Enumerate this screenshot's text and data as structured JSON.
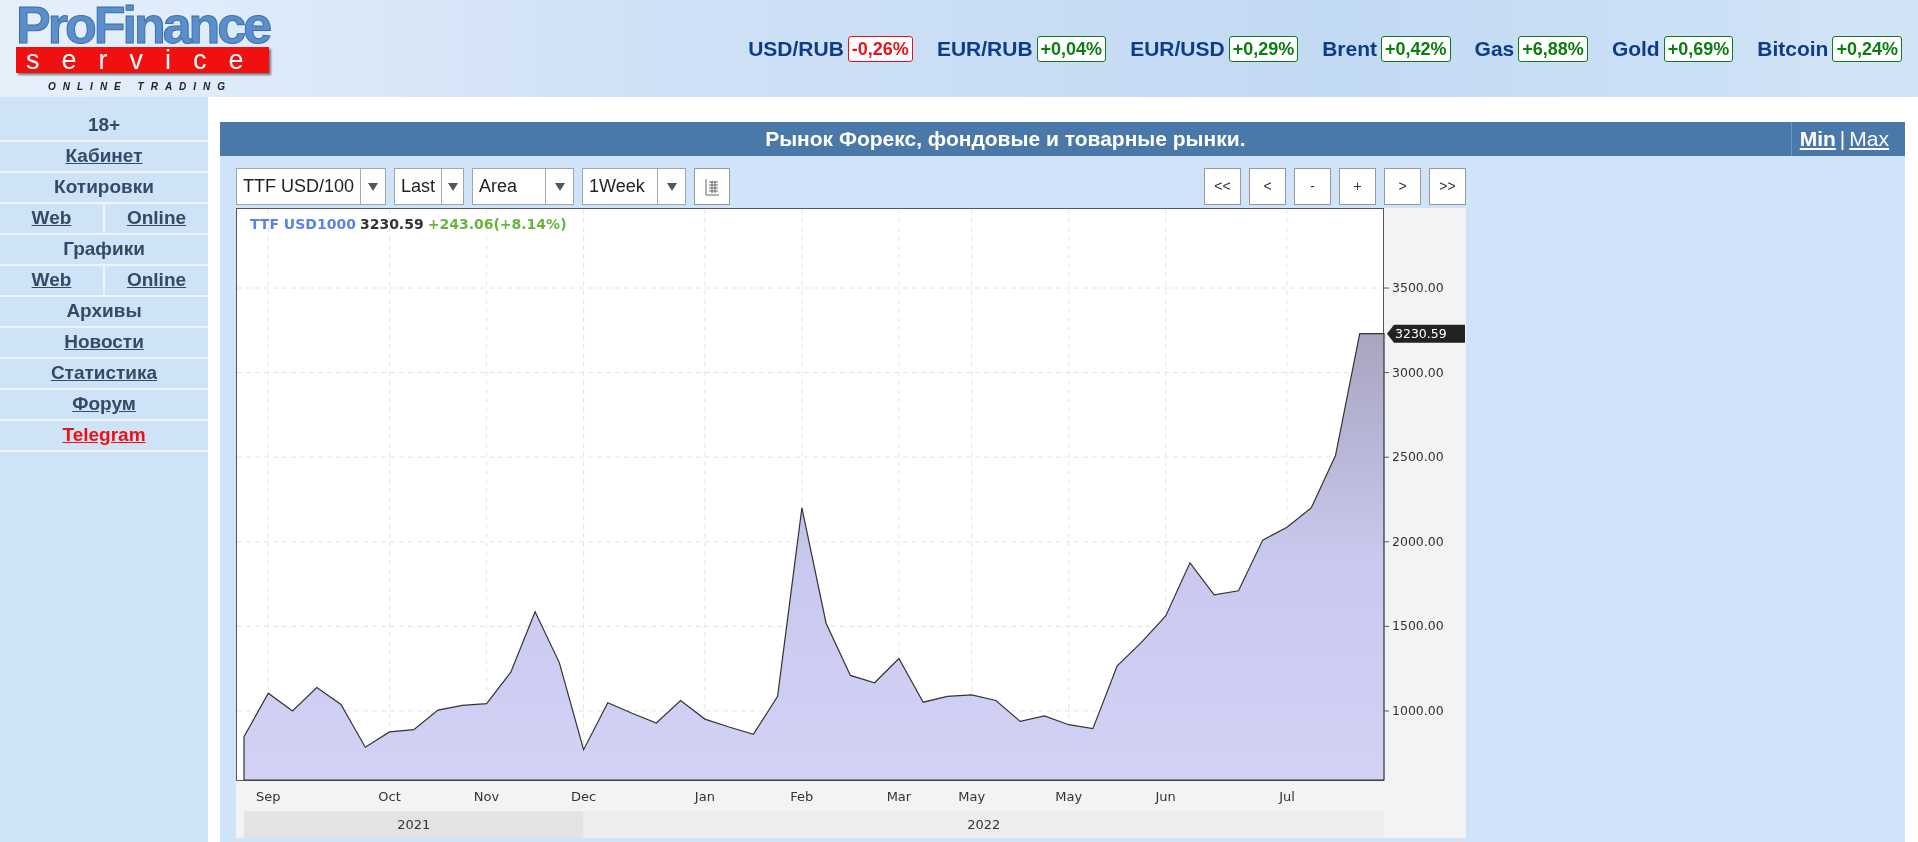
{
  "header": {
    "logo": {
      "brand": "ProFinance",
      "sub": "service",
      "tagline": "ONLINE TRADING"
    },
    "tickers": [
      {
        "name": "USD/RUB",
        "change": "-0,26%",
        "color": "#e4141e"
      },
      {
        "name": "EUR/RUB",
        "change": "+0,04%",
        "color": "#0c7d12"
      },
      {
        "name": "EUR/USD",
        "change": "+0,29%",
        "color": "#0c7d12"
      },
      {
        "name": "Brent",
        "change": "+0,42%",
        "color": "#0c7d12"
      },
      {
        "name": "Gas",
        "change": "+6,88%",
        "color": "#0c7d12"
      },
      {
        "name": "Gold",
        "change": "+0,69%",
        "color": "#0c7d12"
      },
      {
        "name": "Bitcoin",
        "change": "+0,24%",
        "color": "#0c7d12"
      }
    ]
  },
  "sidebar": {
    "items": [
      {
        "kind": "heading",
        "label": "18+"
      },
      {
        "kind": "link",
        "label": "Кабинет"
      },
      {
        "kind": "heading",
        "label": "Котировки"
      },
      {
        "kind": "pair",
        "links": [
          "Web",
          "Online"
        ]
      },
      {
        "kind": "heading",
        "label": "Графики"
      },
      {
        "kind": "pair",
        "links": [
          "Web",
          "Online"
        ]
      },
      {
        "kind": "heading",
        "label": "Архивы"
      },
      {
        "kind": "link",
        "label": "Новости"
      },
      {
        "kind": "link",
        "label": "Статистика"
      },
      {
        "kind": "link",
        "label": "Форум"
      },
      {
        "kind": "accent",
        "label": "Telegram"
      }
    ]
  },
  "panel": {
    "title": "Рынок Форекс, фондовые и товарные рынки.",
    "size_links": [
      {
        "label": "Min",
        "selected": true
      },
      {
        "label": "Max",
        "selected": false
      }
    ],
    "separator": "|",
    "selects": [
      {
        "value": "TTF USD/100"
      },
      {
        "value": "Last"
      },
      {
        "value": "Area"
      },
      {
        "value": "1Week"
      }
    ],
    "nav_buttons": [
      "<<",
      "<",
      "-",
      "+",
      ">",
      ">>"
    ],
    "chart": {
      "legend": {
        "price": "3230.59",
        "change": "+243.06(+8.14%)"
      },
      "price_tag": "3230.59",
      "years": [
        {
          "label": "2021"
        },
        {
          "label": "2022"
        }
      ],
      "chart_data": {
        "type": "area",
        "categories": [
          null,
          "Sep",
          null,
          null,
          null,
          null,
          "Oct",
          null,
          null,
          null,
          "Nov",
          null,
          null,
          null,
          "Dec",
          null,
          null,
          null,
          null,
          "Jan",
          null,
          null,
          null,
          "Feb",
          null,
          null,
          null,
          "Mar",
          null,
          null,
          "May",
          null,
          null,
          null,
          "May",
          null,
          null,
          null,
          "Jun",
          null,
          null,
          null,
          null,
          "Jul",
          null,
          null,
          null,
          null
        ],
        "series": [
          {
            "name": "TTF USD1000",
            "color": "#333333",
            "values": [
              848,
              1105,
              1000,
              1138,
              1038,
              786,
              876,
              890,
              1005,
              1033,
              1043,
              1229,
              1586,
              1286,
              771,
              1048,
              986,
              929,
              1062,
              952,
              905,
              862,
              1086,
              2200,
              1519,
              1210,
              1167,
              1310,
              1052,
              1086,
              1095,
              1062,
              938,
              971,
              919,
              895,
              1267,
              1405,
              1562,
              1876,
              1686,
              1710,
              2010,
              2086,
              2200,
              2510,
              3230,
              3230
            ]
          }
        ],
        "ylim": [
          586,
          3973
        ],
        "grid": true,
        "yticks": [
          {
            "value": 1000,
            "label": "1000.00"
          },
          {
            "value": 1500,
            "label": "1500.00"
          },
          {
            "value": 2000,
            "label": "2000.00"
          },
          {
            "value": 2500,
            "label": "2500.00"
          },
          {
            "value": 3000,
            "label": "3000.00"
          },
          {
            "value": 3500,
            "label": "3500.00"
          }
        ]
      }
    }
  }
}
